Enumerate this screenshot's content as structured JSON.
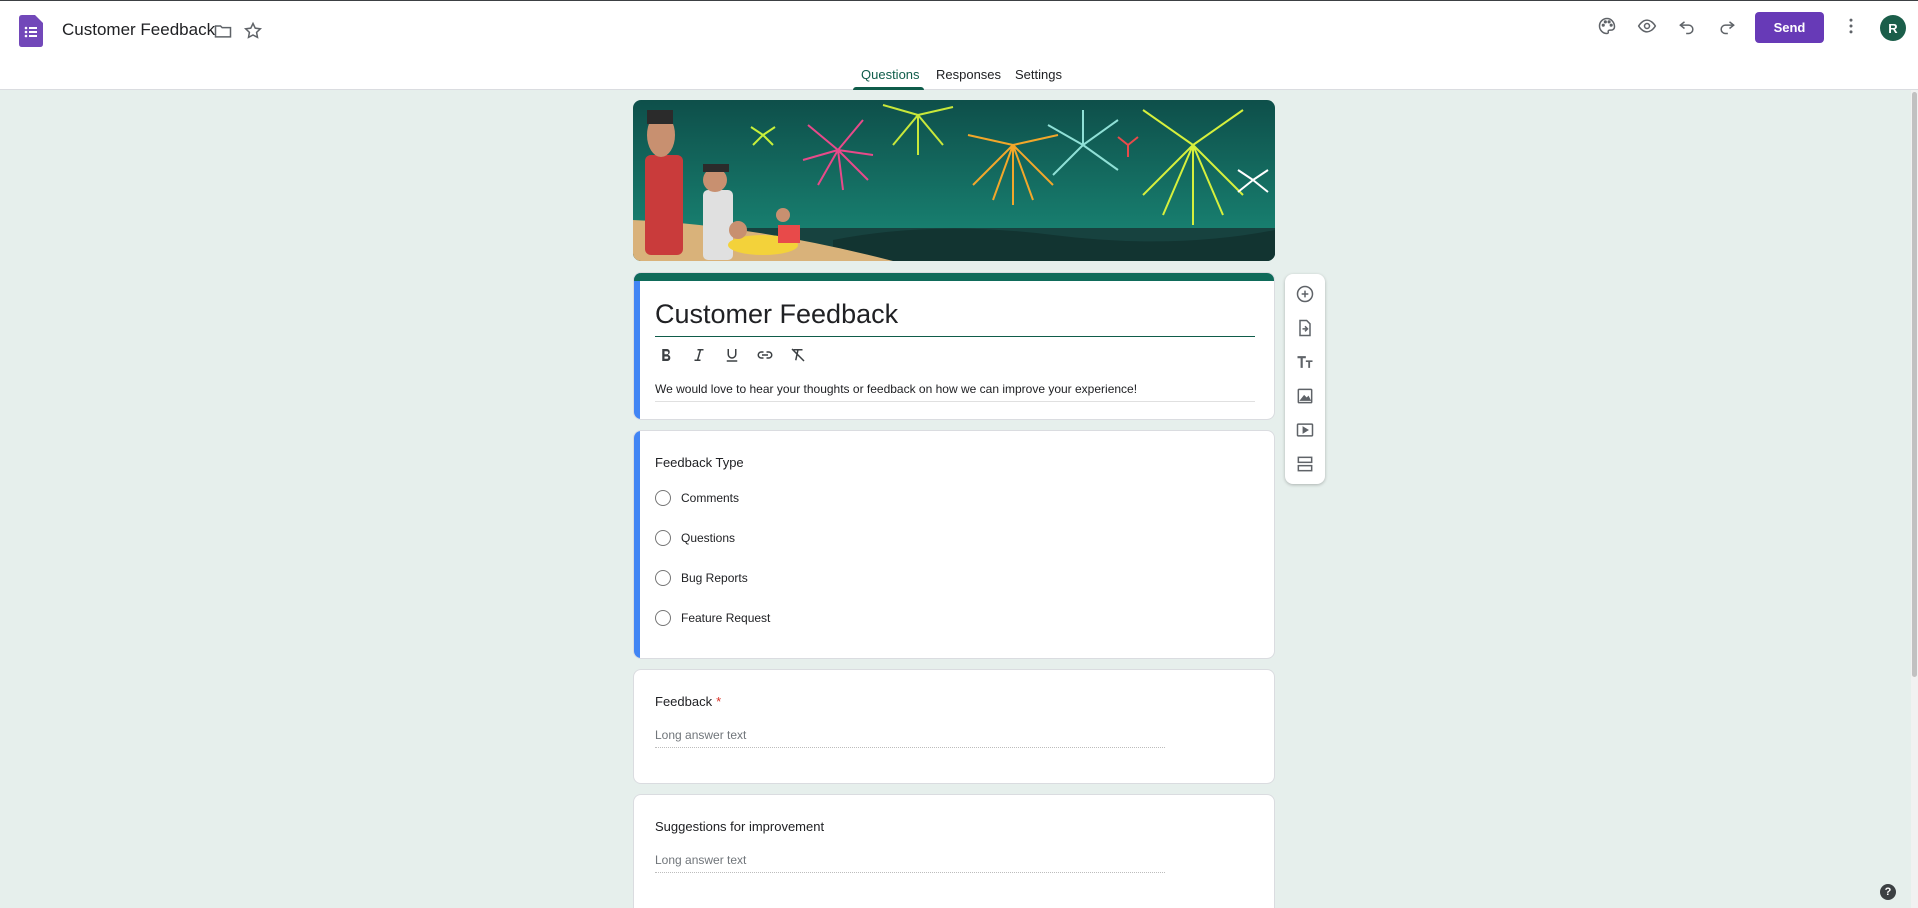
{
  "header": {
    "doc_title": "Customer Feedback",
    "send_label": "Send",
    "avatar_initial": "R",
    "icons": [
      "forms-logo-icon",
      "folder-icon",
      "star-icon",
      "palette-icon",
      "eye-icon",
      "undo-icon",
      "redo-icon",
      "more-vert-icon"
    ]
  },
  "tabs": [
    {
      "label": "Questions",
      "active": true
    },
    {
      "label": "Responses",
      "active": false
    },
    {
      "label": "Settings",
      "active": false
    }
  ],
  "form": {
    "title": "Customer Feedback",
    "description": "We would love to hear your thoughts or feedback on how we can improve your experience!",
    "format_tools": [
      "bold-icon",
      "italic-icon",
      "underline-icon",
      "link-icon",
      "clear-format-icon"
    ]
  },
  "questions": [
    {
      "title": "Feedback Type",
      "type": "multiple-choice",
      "options": [
        "Comments",
        "Questions",
        "Bug Reports",
        "Feature Request"
      ]
    },
    {
      "title": "Feedback",
      "required": true,
      "required_mark": "*",
      "type": "paragraph",
      "placeholder": "Long answer text"
    },
    {
      "title": "Suggestions for improvement",
      "type": "paragraph",
      "placeholder": "Long answer text"
    }
  ],
  "side_toolbar": [
    "add-question-icon",
    "import-questions-icon",
    "add-title-icon",
    "add-image-icon",
    "add-video-icon",
    "add-section-icon"
  ],
  "help_label": "?",
  "colors": {
    "accent": "#673ab7",
    "theme": "#0f6b5a",
    "background": "#e6efec",
    "active_card": "#4285f4",
    "required": "#d93025"
  }
}
